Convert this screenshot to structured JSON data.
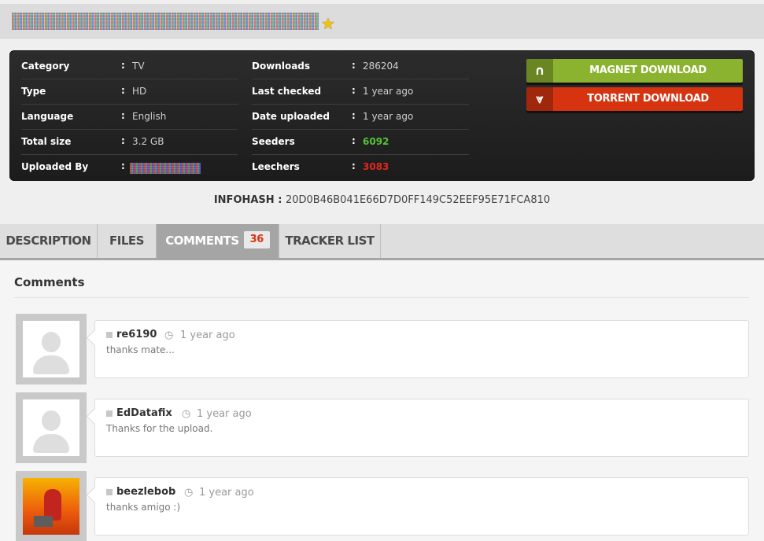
{
  "header": {
    "title_obscured": true
  },
  "info": {
    "left": [
      {
        "label": "Category",
        "value": "TV"
      },
      {
        "label": "Type",
        "value": "HD"
      },
      {
        "label": "Language",
        "value": "English"
      },
      {
        "label": "Total size",
        "value": "3.2 GB"
      },
      {
        "label": "Uploaded By",
        "value": ""
      }
    ],
    "right": [
      {
        "label": "Downloads",
        "value": "286204"
      },
      {
        "label": "Last checked",
        "value": "1 year ago"
      },
      {
        "label": "Date uploaded",
        "value": "1 year ago"
      },
      {
        "label": "Seeders",
        "value": "6092"
      },
      {
        "label": "Leechers",
        "value": "3083"
      }
    ]
  },
  "buttons": {
    "magnet": "MAGNET DOWNLOAD",
    "torrent": "TORRENT DOWNLOAD"
  },
  "infohash": {
    "label": "INFOHASH",
    "value": "20D0B46B041E66D7D0FF149C52EEF95E71FCA810"
  },
  "tabs": [
    {
      "label": "DESCRIPTION"
    },
    {
      "label": "FILES"
    },
    {
      "label": "COMMENTS",
      "badge": "36"
    },
    {
      "label": "TRACKER LIST"
    }
  ],
  "comments": {
    "heading": "Comments",
    "items": [
      {
        "user": "re6190",
        "time": "1 year ago",
        "text": "thanks mate..."
      },
      {
        "user": "EdDatafix",
        "time": "1 year ago",
        "text": "Thanks for the upload."
      },
      {
        "user": "beezlebob",
        "time": "1 year ago",
        "text": "thanks amigo :)"
      }
    ]
  },
  "icons": {
    "favorite": "star-icon",
    "magnet": "magnet-icon",
    "torrent": "double-chevron-down-icon",
    "time": "clock-icon"
  },
  "colors": {
    "magnet": "#8cb32f",
    "torrent": "#d63410",
    "seeders": "#56c238",
    "leechers": "#e3281b",
    "star": "#f4c20d"
  }
}
